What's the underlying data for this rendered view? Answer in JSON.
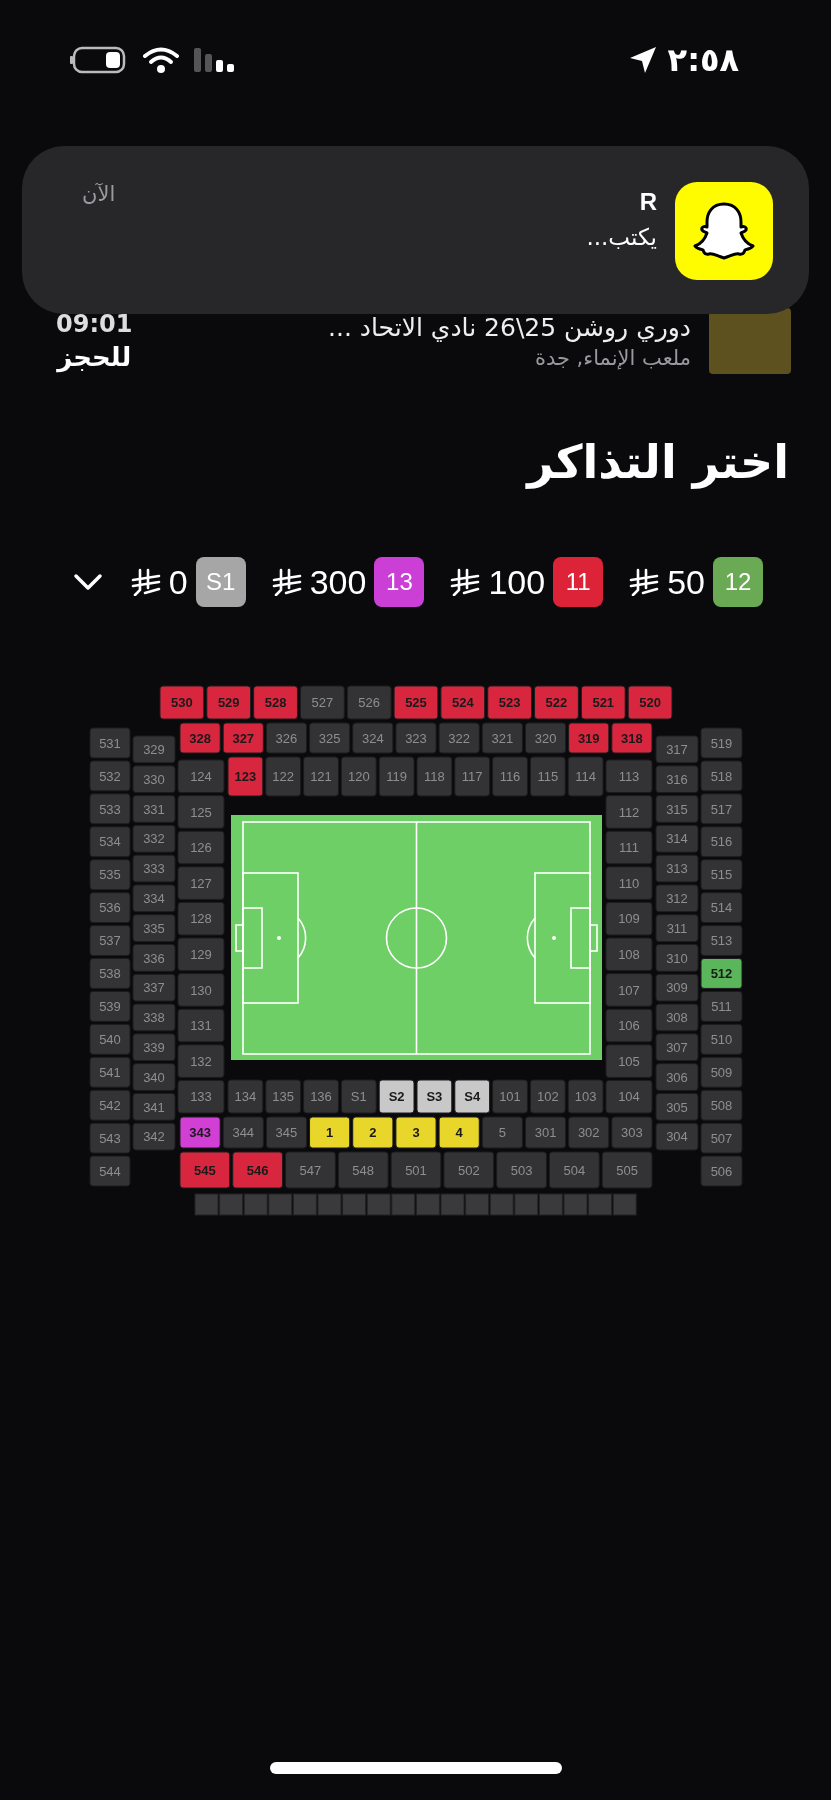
{
  "status_bar": {
    "time": "٢:٥٨"
  },
  "notification": {
    "app_title": "R",
    "message": "يكتب...",
    "time": "الآن"
  },
  "event": {
    "title": "دوري روشن 25\\26 نادي الاتحاد ...",
    "venue": "ملعب الإنماء, جدة",
    "time": "09:01",
    "action": "للحجز"
  },
  "heading": "اختر التذاكر",
  "price_tiers": [
    {
      "badge": "S1",
      "color": "#a6a6a6",
      "price": "0"
    },
    {
      "badge": "13",
      "color": "#cc3fd6",
      "price": "300"
    },
    {
      "badge": "11",
      "color": "#dc2338",
      "price": "100"
    },
    {
      "badge": "12",
      "color": "#6aaa55",
      "price": "50"
    }
  ],
  "stadium_map": {
    "top_upper": [
      {
        "label": "530",
        "color": "#d9263f"
      },
      {
        "label": "529",
        "color": "#d9263f"
      },
      {
        "label": "528",
        "color": "#d9263f"
      },
      {
        "label": "527",
        "color": "#333335"
      },
      {
        "label": "526",
        "color": "#333335"
      },
      {
        "label": "525",
        "color": "#d9263f"
      },
      {
        "label": "524",
        "color": "#d9263f"
      },
      {
        "label": "523",
        "color": "#d9263f"
      },
      {
        "label": "522",
        "color": "#d9263f"
      },
      {
        "label": "521",
        "color": "#d9263f"
      },
      {
        "label": "520",
        "color": "#d9263f"
      }
    ],
    "top_middle": [
      {
        "label": "328",
        "color": "#d9263f"
      },
      {
        "label": "327",
        "color": "#d9263f"
      },
      {
        "label": "326",
        "color": "#333335"
      },
      {
        "label": "325",
        "color": "#333335"
      },
      {
        "label": "324",
        "color": "#333335"
      },
      {
        "label": "323",
        "color": "#333335"
      },
      {
        "label": "322",
        "color": "#333335"
      },
      {
        "label": "321",
        "color": "#333335"
      },
      {
        "label": "320",
        "color": "#333335"
      },
      {
        "label": "319",
        "color": "#d9263f"
      },
      {
        "label": "318",
        "color": "#d9263f"
      }
    ],
    "top_lower": [
      {
        "label": "123",
        "color": "#d9263f"
      },
      {
        "label": "122",
        "color": "#333335"
      },
      {
        "label": "121",
        "color": "#333335"
      },
      {
        "label": "120",
        "color": "#333335"
      },
      {
        "label": "119",
        "color": "#333335"
      },
      {
        "label": "118",
        "color": "#333335"
      },
      {
        "label": "117",
        "color": "#333335"
      },
      {
        "label": "116",
        "color": "#333335"
      },
      {
        "label": "115",
        "color": "#333335"
      },
      {
        "label": "114",
        "color": "#333335"
      }
    ],
    "left_outer": [
      {
        "label": "531",
        "color": "#333335"
      },
      {
        "label": "532",
        "color": "#333335"
      },
      {
        "label": "533",
        "color": "#333335"
      },
      {
        "label": "534",
        "color": "#333335"
      },
      {
        "label": "535",
        "color": "#333335"
      },
      {
        "label": "536",
        "color": "#333335"
      },
      {
        "label": "537",
        "color": "#333335"
      },
      {
        "label": "538",
        "color": "#333335"
      },
      {
        "label": "539",
        "color": "#333335"
      },
      {
        "label": "540",
        "color": "#333335"
      },
      {
        "label": "541",
        "color": "#333335"
      },
      {
        "label": "542",
        "color": "#333335"
      },
      {
        "label": "543",
        "color": "#333335"
      },
      {
        "label": "544",
        "color": "#333335"
      }
    ],
    "left_middle": [
      {
        "label": "329",
        "color": "#333335"
      },
      {
        "label": "330",
        "color": "#333335"
      },
      {
        "label": "331",
        "color": "#333335"
      },
      {
        "label": "332",
        "color": "#333335"
      },
      {
        "label": "333",
        "color": "#333335"
      },
      {
        "label": "334",
        "color": "#333335"
      },
      {
        "label": "335",
        "color": "#333335"
      },
      {
        "label": "336",
        "color": "#333335"
      },
      {
        "label": "337",
        "color": "#333335"
      },
      {
        "label": "338",
        "color": "#333335"
      },
      {
        "label": "339",
        "color": "#333335"
      },
      {
        "label": "340",
        "color": "#333335"
      },
      {
        "label": "341",
        "color": "#333335"
      },
      {
        "label": "342",
        "color": "#333335"
      }
    ],
    "left_inner": [
      {
        "label": "124",
        "color": "#333335"
      },
      {
        "label": "125",
        "color": "#333335"
      },
      {
        "label": "126",
        "color": "#333335"
      },
      {
        "label": "127",
        "color": "#333335"
      },
      {
        "label": "128",
        "color": "#333335"
      },
      {
        "label": "129",
        "color": "#333335"
      },
      {
        "label": "130",
        "color": "#333335"
      },
      {
        "label": "131",
        "color": "#333335"
      },
      {
        "label": "132",
        "color": "#333335"
      },
      {
        "label": "133",
        "color": "#333335"
      }
    ],
    "right_inner": [
      {
        "label": "113",
        "color": "#333335"
      },
      {
        "label": "112",
        "color": "#333335"
      },
      {
        "label": "111",
        "color": "#333335"
      },
      {
        "label": "110",
        "color": "#333335"
      },
      {
        "label": "109",
        "color": "#333335"
      },
      {
        "label": "108",
        "color": "#333335"
      },
      {
        "label": "107",
        "color": "#333335"
      },
      {
        "label": "106",
        "color": "#333335"
      },
      {
        "label": "105",
        "color": "#333335"
      },
      {
        "label": "104",
        "color": "#333335"
      }
    ],
    "right_middle": [
      {
        "label": "317",
        "color": "#333335"
      },
      {
        "label": "316",
        "color": "#333335"
      },
      {
        "label": "315",
        "color": "#333335"
      },
      {
        "label": "314",
        "color": "#333335"
      },
      {
        "label": "313",
        "color": "#333335"
      },
      {
        "label": "312",
        "color": "#333335"
      },
      {
        "label": "311",
        "color": "#333335"
      },
      {
        "label": "310",
        "color": "#333335"
      },
      {
        "label": "309",
        "color": "#333335"
      },
      {
        "label": "308",
        "color": "#333335"
      },
      {
        "label": "307",
        "color": "#333335"
      },
      {
        "label": "306",
        "color": "#333335"
      },
      {
        "label": "305",
        "color": "#333335"
      },
      {
        "label": "304",
        "color": "#333335"
      }
    ],
    "right_outer": [
      {
        "label": "519",
        "color": "#333335"
      },
      {
        "label": "518",
        "color": "#333335"
      },
      {
        "label": "517",
        "color": "#333335"
      },
      {
        "label": "516",
        "color": "#333335"
      },
      {
        "label": "515",
        "color": "#333335"
      },
      {
        "label": "514",
        "color": "#333335"
      },
      {
        "label": "513",
        "color": "#333335"
      },
      {
        "label": "512",
        "color": "#5bb55a"
      },
      {
        "label": "511",
        "color": "#333335"
      },
      {
        "label": "510",
        "color": "#333335"
      },
      {
        "label": "509",
        "color": "#333335"
      },
      {
        "label": "508",
        "color": "#333335"
      },
      {
        "label": "507",
        "color": "#333335"
      },
      {
        "label": "506",
        "color": "#333335"
      }
    ],
    "bottom_inner": [
      {
        "label": "134",
        "color": "#333335"
      },
      {
        "label": "135",
        "color": "#333335"
      },
      {
        "label": "136",
        "color": "#333335"
      },
      {
        "label": "S1",
        "color": "#333335"
      },
      {
        "label": "S2",
        "color": "#c8c8c8"
      },
      {
        "label": "S3",
        "color": "#c8c8c8"
      },
      {
        "label": "S4",
        "color": "#c8c8c8"
      },
      {
        "label": "101",
        "color": "#333335"
      },
      {
        "label": "102",
        "color": "#333335"
      },
      {
        "label": "103",
        "color": "#333335"
      }
    ],
    "bottom_middle": [
      {
        "label": "343",
        "color": "#d23fd4"
      },
      {
        "label": "344",
        "color": "#333335"
      },
      {
        "label": "345",
        "color": "#333335"
      },
      {
        "label": "1",
        "color": "#e8d62a"
      },
      {
        "label": "2",
        "color": "#e8d62a"
      },
      {
        "label": "3",
        "color": "#e8d62a"
      },
      {
        "label": "4",
        "color": "#e8d62a"
      },
      {
        "label": "5",
        "color": "#333335"
      },
      {
        "label": "301",
        "color": "#333335"
      },
      {
        "label": "302",
        "color": "#333335"
      },
      {
        "label": "303",
        "color": "#333335"
      }
    ],
    "bottom_outer": [
      {
        "label": "545",
        "color": "#d9263f"
      },
      {
        "label": "546",
        "color": "#d9263f"
      },
      {
        "label": "547",
        "color": "#333335"
      },
      {
        "label": "548",
        "color": "#333335"
      },
      {
        "label": "501",
        "color": "#333335"
      },
      {
        "label": "502",
        "color": "#333335"
      },
      {
        "label": "503",
        "color": "#333335"
      },
      {
        "label": "504",
        "color": "#333335"
      },
      {
        "label": "505",
        "color": "#333335"
      }
    ]
  }
}
